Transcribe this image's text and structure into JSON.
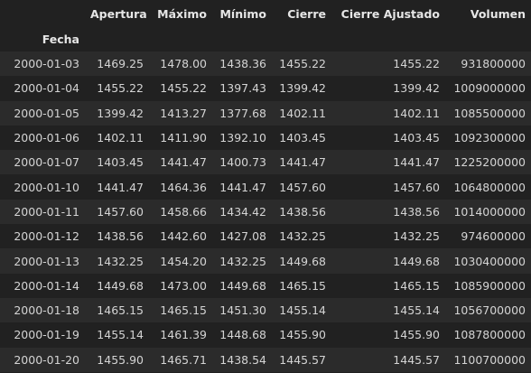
{
  "table": {
    "index_name": "Fecha",
    "columns": [
      "Apertura",
      "Máximo",
      "Mínimo",
      "Cierre",
      "Cierre Ajustado",
      "Volumen"
    ],
    "rows": [
      {
        "index": "2000-01-03",
        "cells": [
          "1469.25",
          "1478.00",
          "1438.36",
          "1455.22",
          "1455.22",
          "931800000"
        ]
      },
      {
        "index": "2000-01-04",
        "cells": [
          "1455.22",
          "1455.22",
          "1397.43",
          "1399.42",
          "1399.42",
          "1009000000"
        ]
      },
      {
        "index": "2000-01-05",
        "cells": [
          "1399.42",
          "1413.27",
          "1377.68",
          "1402.11",
          "1402.11",
          "1085500000"
        ]
      },
      {
        "index": "2000-01-06",
        "cells": [
          "1402.11",
          "1411.90",
          "1392.10",
          "1403.45",
          "1403.45",
          "1092300000"
        ]
      },
      {
        "index": "2000-01-07",
        "cells": [
          "1403.45",
          "1441.47",
          "1400.73",
          "1441.47",
          "1441.47",
          "1225200000"
        ]
      },
      {
        "index": "2000-01-10",
        "cells": [
          "1441.47",
          "1464.36",
          "1441.47",
          "1457.60",
          "1457.60",
          "1064800000"
        ]
      },
      {
        "index": "2000-01-11",
        "cells": [
          "1457.60",
          "1458.66",
          "1434.42",
          "1438.56",
          "1438.56",
          "1014000000"
        ]
      },
      {
        "index": "2000-01-12",
        "cells": [
          "1438.56",
          "1442.60",
          "1427.08",
          "1432.25",
          "1432.25",
          "974600000"
        ]
      },
      {
        "index": "2000-01-13",
        "cells": [
          "1432.25",
          "1454.20",
          "1432.25",
          "1449.68",
          "1449.68",
          "1030400000"
        ]
      },
      {
        "index": "2000-01-14",
        "cells": [
          "1449.68",
          "1473.00",
          "1449.68",
          "1465.15",
          "1465.15",
          "1085900000"
        ]
      },
      {
        "index": "2000-01-18",
        "cells": [
          "1465.15",
          "1465.15",
          "1451.30",
          "1455.14",
          "1455.14",
          "1056700000"
        ]
      },
      {
        "index": "2000-01-19",
        "cells": [
          "1455.14",
          "1461.39",
          "1448.68",
          "1455.90",
          "1455.90",
          "1087800000"
        ]
      },
      {
        "index": "2000-01-20",
        "cells": [
          "1455.90",
          "1465.71",
          "1438.54",
          "1445.57",
          "1445.57",
          "1100700000"
        ]
      }
    ]
  }
}
